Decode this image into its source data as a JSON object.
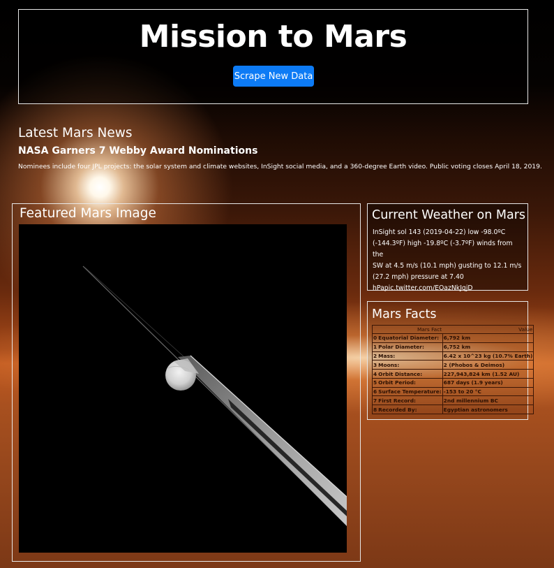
{
  "header": {
    "title": "Mission to Mars",
    "scrape_button": "Scrape New Data"
  },
  "news": {
    "heading": "Latest Mars News",
    "title": "NASA Garners 7 Webby Award Nominations",
    "body": "Nominees include four JPL projects: the solar system and climate websites, InSight social media, and a 360-degree Earth video. Public voting closes April 18, 2019."
  },
  "featured": {
    "heading": "Featured Mars Image"
  },
  "weather": {
    "heading": "Current Weather on Mars",
    "lines": [
      "InSight sol 143 (2019-04-22) low -98.0ºC",
      "(-144.3ºF) high -19.8ºC (-3.7ºF) winds from the",
      "SW at 4.5 m/s (10.1 mph) gusting to 12.1 m/s",
      "(27.2 mph) pressure at 7.40",
      "hPapic.twitter.com/EOazNkJqjD"
    ]
  },
  "facts": {
    "heading": "Mars Facts",
    "columns": [
      "Mars Fact",
      "Value"
    ],
    "rows": [
      {
        "index": "0",
        "label": "Equatorial Diameter:",
        "value": "6,792 km"
      },
      {
        "index": "1",
        "label": "Polar Diameter:",
        "value": "6,752 km"
      },
      {
        "index": "2",
        "label": "Mass:",
        "value": "6.42 x 10^23 kg (10.7% Earth)"
      },
      {
        "index": "3",
        "label": "Moons:",
        "value": "2 (Phobos & Deimos)"
      },
      {
        "index": "4",
        "label": "Orbit Distance:",
        "value": "227,943,824 km (1.52 AU)"
      },
      {
        "index": "5",
        "label": "Orbit Period:",
        "value": "687 days (1.9 years)"
      },
      {
        "index": "6",
        "label": "Surface Temperature:",
        "value": "-153 to 20 °C"
      },
      {
        "index": "7",
        "label": "First Record:",
        "value": "2nd millennium BC"
      },
      {
        "index": "8",
        "label": "Recorded By:",
        "value": "Egyptian astronomers"
      }
    ]
  }
}
